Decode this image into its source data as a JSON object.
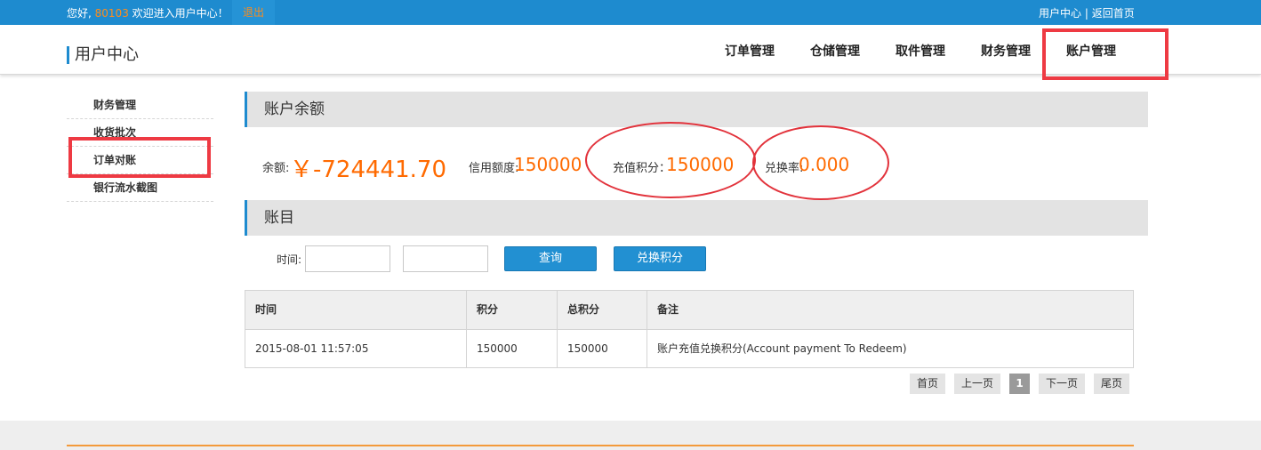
{
  "topbar": {
    "greeting_prefix": "您好,",
    "user_id": "80103",
    "greeting_suffix": "欢迎进入用户中心！",
    "logout": "退出",
    "user_center": "用户中心",
    "separator": "|",
    "back_home": "返回首页"
  },
  "header": {
    "brand": "用户中心",
    "nav": [
      "订单管理",
      "仓储管理",
      "取件管理",
      "财务管理",
      "账户管理"
    ],
    "selected_nav": "账户管理"
  },
  "sidebar": {
    "items": [
      "财务管理",
      "收货批次",
      "订单对账",
      "银行流水截图"
    ],
    "highlighted": "订单对账"
  },
  "balance_section": {
    "title": "账户余额",
    "balance_label": "余额:",
    "balance_value": "￥-724441.70",
    "credit_label": "信用额度:",
    "credit_value": "150000",
    "recharge_label": "充值积分：",
    "recharge_value": "150000",
    "rate_label": "兑换率:",
    "rate_value": "0.000"
  },
  "account_section": {
    "title": "账目",
    "time_label": "时间:",
    "start_value": "",
    "end_value": "",
    "query_button": "查询",
    "redeem_button": "兑换积分"
  },
  "table": {
    "headers": [
      "时间",
      "积分",
      "总积分",
      "备注"
    ],
    "rows": [
      [
        "2015-08-01 11:57:05",
        "150000",
        "150000",
        "账户充值兑换积分(Account payment To Redeem)"
      ]
    ]
  },
  "pager": {
    "first": "首页",
    "prev": "上一页",
    "current": "1",
    "next": "下一页",
    "last": "尾页"
  },
  "colors": {
    "topbar_blue": "#1e8bcf",
    "accent_orange": "#ff6a00",
    "annotation_red": "#ee3a43"
  }
}
